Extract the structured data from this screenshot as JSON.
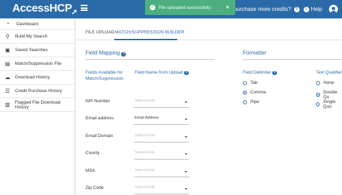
{
  "header": {
    "logo_text": "AccessHCP",
    "purchase_text": "ant to purchase more credits?",
    "help_label": "Help"
  },
  "toast": {
    "message": "File uploaded successfully.",
    "close_label": "×"
  },
  "sidebar": {
    "items": [
      {
        "label": "Dashboard",
        "icon": "dashboard-icon"
      },
      {
        "label": "Build My Search",
        "icon": "search-icon"
      },
      {
        "label": "Saved Searches",
        "icon": "save-icon"
      },
      {
        "label": "Match/Suppression File",
        "icon": "file-icon"
      },
      {
        "label": "Download History",
        "icon": "cloud-download-icon"
      },
      {
        "label": "Credit Purchase History",
        "icon": "list-icon"
      },
      {
        "label": "Flagged File Download History",
        "icon": "flagged-file-icon"
      }
    ]
  },
  "tabs": {
    "file_upload": "FILE UPLOAD",
    "match_builder": "MATCH/SUPPRESSION BUILDER"
  },
  "field_mapping": {
    "title": "Field Mapping",
    "col_available": "Fields Available for Match/Suppression",
    "col_name": "Field Name from Upload",
    "rows": [
      {
        "label": "NPI Number",
        "value": "Select Field"
      },
      {
        "label": "Email address",
        "value": "Email Address"
      },
      {
        "label": "Email Domain",
        "value": "Select Field"
      },
      {
        "label": "County",
        "value": "Select Field"
      },
      {
        "label": "MSA",
        "value": "Select Field"
      },
      {
        "label": "Zip Code",
        "value": "Select Field"
      }
    ]
  },
  "formatter": {
    "title": "Formatter",
    "delimiter_label": "Field Delimiter",
    "delimiter_options": [
      "Tab",
      "Comma",
      "Pipe"
    ],
    "delimiter_selected": "Comma",
    "qualifier_label": "Text Qualifier",
    "qualifier_options": [
      "None",
      "Double Qu",
      "Single Quo"
    ],
    "qualifier_selected": "Double Qu"
  }
}
